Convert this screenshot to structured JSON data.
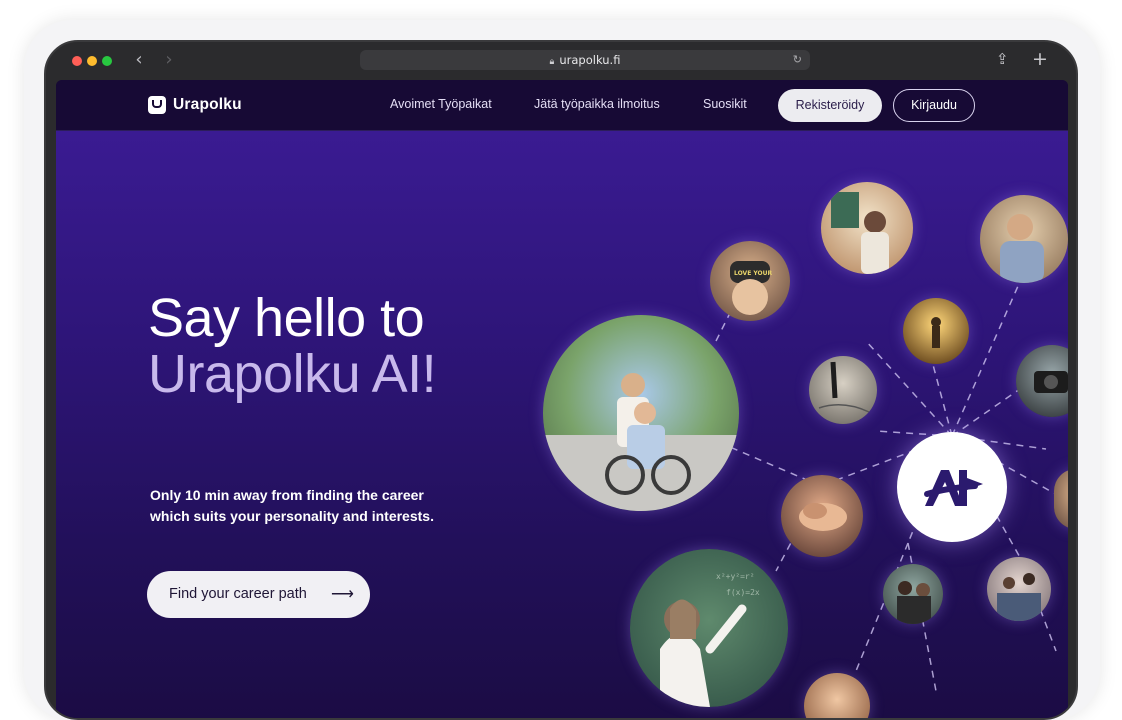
{
  "browser": {
    "url": "urapolku.fi",
    "lock_icon": "lock-icon",
    "reload_icon": "reload-icon"
  },
  "site": {
    "logo_text": "Urapolku",
    "nav": {
      "jobs": "Avoimet Työpaikat",
      "post_job": "Jätä työpaikka ilmoitus",
      "favorites": "Suosikit",
      "register": "Rekisteröidy",
      "login": "Kirjaudu"
    }
  },
  "hero": {
    "title_line1": "Say hello to",
    "title_line2": "Urapolku AI!",
    "subtitle_line1": "Only 10 min away from finding the career",
    "subtitle_line2": "which suits your personality and interests.",
    "cta_label": "Find your career path",
    "cta_arrow": "⟶"
  },
  "colors": {
    "nav_bg": "#170a35",
    "hero_top": "#3a1b92",
    "hero_bottom": "#1b0c44",
    "title_secondary": "#c8b9ec",
    "accent_purple": "#2b1a6e"
  }
}
